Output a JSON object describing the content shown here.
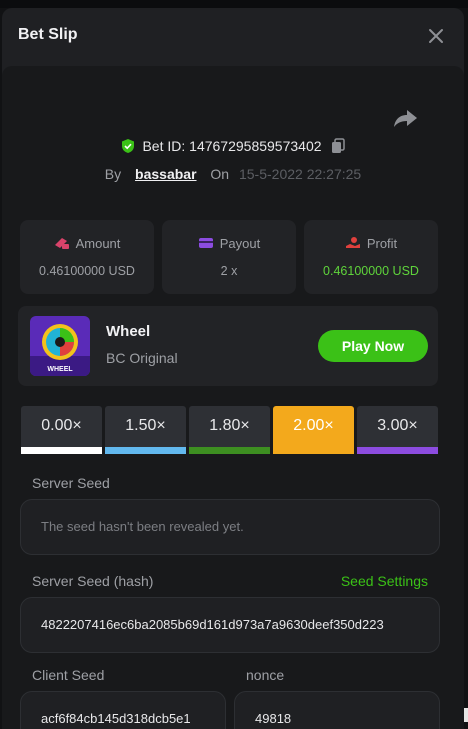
{
  "window": {
    "title": "Bet Slip",
    "close_icon": "close-icon"
  },
  "bet": {
    "id_label": "Bet ID:",
    "id_value": "14767295859573402",
    "by_label": "By",
    "username": "bassabar",
    "on_label": "On",
    "date": "15-5-2022 22:27:25"
  },
  "stats": {
    "amount": {
      "label": "Amount",
      "value": "0.46100000 USD"
    },
    "payout": {
      "label": "Payout",
      "value": "2 x"
    },
    "profit": {
      "label": "Profit",
      "value": "0.46100000 USD"
    }
  },
  "game": {
    "name": "Wheel",
    "subtitle": "BC Original",
    "play_label": "Play Now",
    "thumb_text": "WHEEL"
  },
  "multipliers": [
    {
      "label": "0.00×",
      "color": "#ffffff"
    },
    {
      "label": "1.50×",
      "color": "#62b8ee"
    },
    {
      "label": "1.80×",
      "color": "#3d8f21"
    },
    {
      "label": "2.00×",
      "color": "#f3a91c"
    },
    {
      "label": "3.00×",
      "color": "#8c4ce0"
    }
  ],
  "selected_multiplier": "2.00×",
  "seeds": {
    "server_seed_label": "Server Seed",
    "server_seed_value": "The seed hasn't been revealed yet.",
    "server_hash_label": "Server Seed (hash)",
    "seed_settings_label": "Seed Settings",
    "server_hash_value": "4822207416ec6ba2085b69d161d973a7a9630deef350d223",
    "client_seed_label": "Client Seed",
    "client_seed_value": "acf6f84cb145d318dcb5e1",
    "nonce_label": "nonce",
    "nonce_value": "49818"
  },
  "colors": {
    "accent_green": "#3bc117",
    "profit_green": "#5fd43b",
    "selected_orange": "#f3a91c"
  }
}
